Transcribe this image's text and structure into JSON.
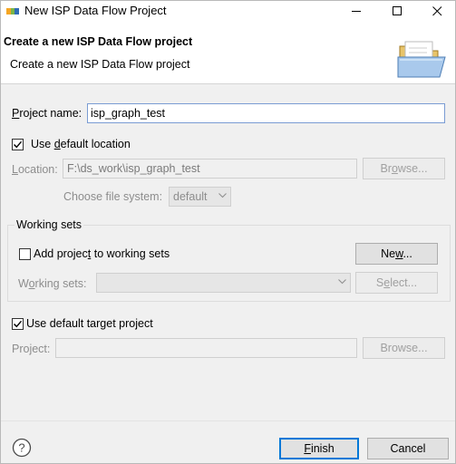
{
  "window": {
    "title": "New ISP Data Flow Project"
  },
  "banner": {
    "title": "Create a new ISP Data Flow project",
    "message": "Create a new ISP Data Flow project"
  },
  "project_name": {
    "label_pre": "",
    "label_accel": "P",
    "label_post": "roject name:",
    "value": "isp_graph_test"
  },
  "default_location": {
    "checked": true,
    "label_pre": "Use ",
    "label_accel": "d",
    "label_post": "efault location"
  },
  "location": {
    "label_pre": "",
    "label_accel": "L",
    "label_post": "ocation:",
    "value": "F:\\ds_work\\isp_graph_test",
    "browse_pre": "Br",
    "browse_accel": "o",
    "browse_post": "wse..."
  },
  "file_system": {
    "label": "Choose file system:",
    "selected": "default"
  },
  "working_sets": {
    "group_label": "Working sets",
    "add_checked": false,
    "add_pre": "Add projec",
    "add_accel": "t",
    "add_post": " to working sets",
    "new_pre": "Ne",
    "new_accel": "w",
    "new_post": "...",
    "sets_pre": "W",
    "sets_accel": "o",
    "sets_post": "rking sets:",
    "select_pre": "S",
    "select_accel": "e",
    "select_post": "lect..."
  },
  "target_project": {
    "checked": true,
    "label": "Use default target project",
    "project_label": "Project:",
    "browse_label": "Browse..."
  },
  "footer": {
    "finish_pre": "",
    "finish_accel": "F",
    "finish_post": "inish",
    "cancel_label": "Cancel"
  },
  "icons": {
    "app": "nxp-logo-icon",
    "banner": "open-folder-icon",
    "help": "help-icon"
  }
}
